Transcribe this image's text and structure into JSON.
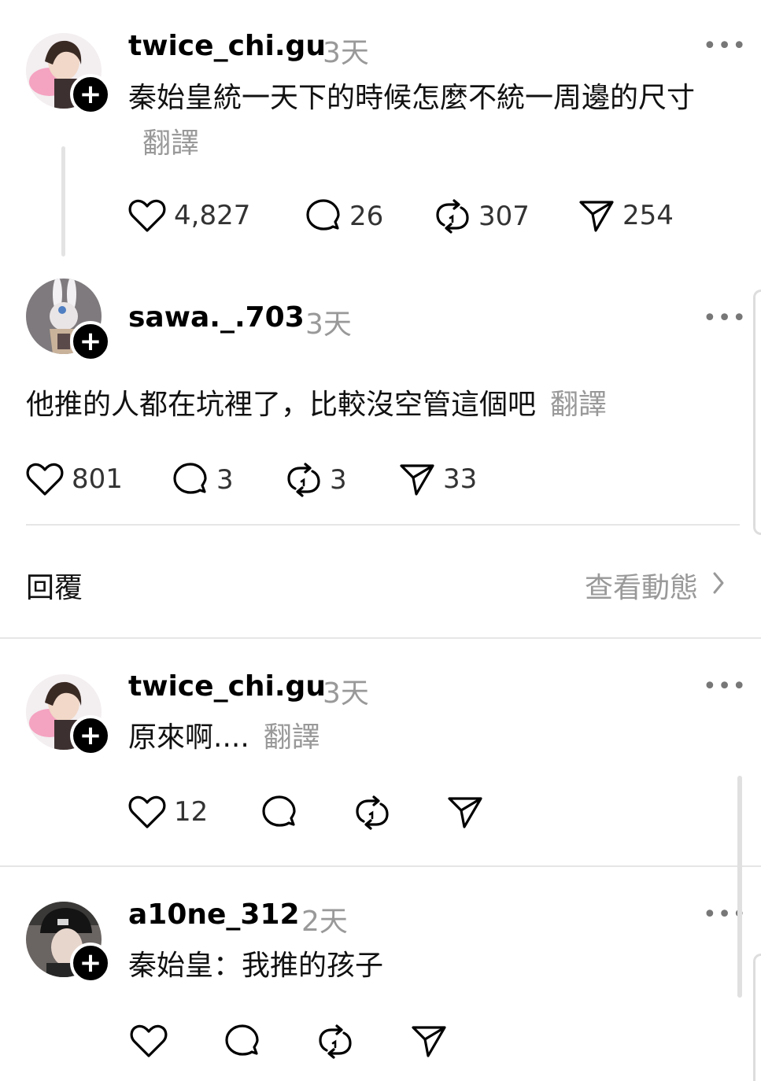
{
  "posts": [
    {
      "username": "twice_chi.gu",
      "time": "3天",
      "text": "秦始皇統一天下的時候怎麼不統一周邊的尺寸",
      "translate": "翻譯",
      "likes": "4,827",
      "comments": "26",
      "reposts": "307",
      "shares": "254"
    },
    {
      "username": "sawa._.703",
      "time": "3天",
      "text": "他推的人都在坑裡了，比較沒空管這個吧",
      "translate": "翻譯",
      "likes": "801",
      "comments": "3",
      "reposts": "3",
      "shares": "33"
    },
    {
      "username": "twice_chi.gu",
      "time": "3天",
      "text": "原來啊....",
      "translate": "翻譯",
      "likes": "12"
    },
    {
      "username": "a10ne_312",
      "time": "2天",
      "text": "秦始皇：我推的孩子"
    }
  ],
  "reply_bar": {
    "reply_label": "回覆",
    "view_activity_label": "查看動態"
  },
  "colors": {
    "muted_text": "#999999",
    "divider": "#e6e6e6"
  }
}
